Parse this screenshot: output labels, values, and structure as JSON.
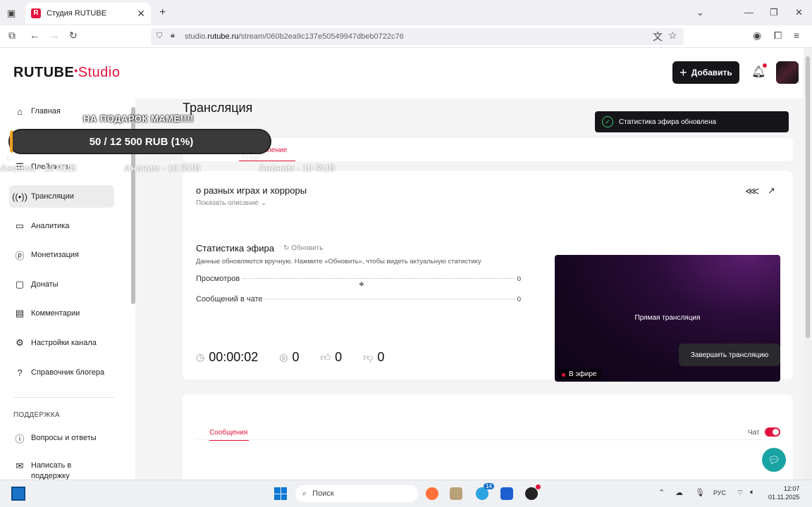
{
  "browser": {
    "tab_title": "Студия RUTUBE",
    "url_prefix": "studio.",
    "url_domain": "rutube.ru",
    "url_path": "/stream/060b2ea9c137e50549947dbeb0722c76"
  },
  "header": {
    "logo": "RUTUBE",
    "logo_suffix": "Studio",
    "add_button": "Добавить"
  },
  "sidebar": {
    "items": [
      {
        "label": "Главная",
        "icon": "home-icon"
      },
      {
        "label": "Плейлисты",
        "icon": "playlist-icon"
      },
      {
        "label": "Трансляции",
        "icon": "broadcast-icon"
      },
      {
        "label": "Аналитика",
        "icon": "analytics-icon"
      },
      {
        "label": "Монетизация",
        "icon": "monetization-icon"
      },
      {
        "label": "Донаты",
        "icon": "donate-icon"
      },
      {
        "label": "Комментарии",
        "icon": "comment-icon"
      },
      {
        "label": "Настройки канала",
        "icon": "settings-icon"
      },
      {
        "label": "Справочник блогера",
        "icon": "help-icon"
      }
    ],
    "support_section": "ПОДДЕРЖКА",
    "support_items": [
      {
        "label": "Вопросы и ответы",
        "icon": "faq-icon"
      },
      {
        "label": "Написать в поддержку",
        "icon": "mail-icon"
      }
    ]
  },
  "main": {
    "title": "Трансляция",
    "tab_partial": "вление"
  },
  "stream": {
    "title": "о разных играх и хорроры",
    "show_description": "Показать описание",
    "stats_title": "Статистика эфира",
    "refresh": "Обновить",
    "stats_hint": "Данные обновляются вручную. Нажмите «Обновить», чтобы видеть актуальную статистику",
    "views_label": "Просмотров",
    "views_value": "0",
    "chat_label": "Сообщений в чате",
    "chat_value": "0",
    "duration": "00:00:02",
    "viewers": "0",
    "likes": "0",
    "dislikes": "0",
    "preview_text": "Прямая трансляция",
    "live_badge": "В эфире",
    "end_button": "Завершить трансляцию"
  },
  "chat": {
    "tab": "Сообщения",
    "toggle_label": "Чат",
    "toggle_on": true
  },
  "toast": {
    "text": "Статистика эфира обновлена"
  },
  "donation_overlay": {
    "goal_title": "НА ПОДАРОК МАМЕ!!!!",
    "progress_text": "50 / 12 500 RUB (1%)",
    "progress_fraction": 0.004,
    "min": "0",
    "max": "12 500",
    "ticker": [
      "Аноним - 10 RUB",
      "Аноним - 10 RUB",
      "Аноним - 10 RUB"
    ]
  },
  "taskbar": {
    "search": "Поиск",
    "lang": "РУС",
    "time": "12:07",
    "date": "01.11.2025",
    "telegram_badge": "14"
  },
  "colors": {
    "accent": "#e4133d",
    "dark_button": "#16161a",
    "success": "#3ec46d"
  }
}
